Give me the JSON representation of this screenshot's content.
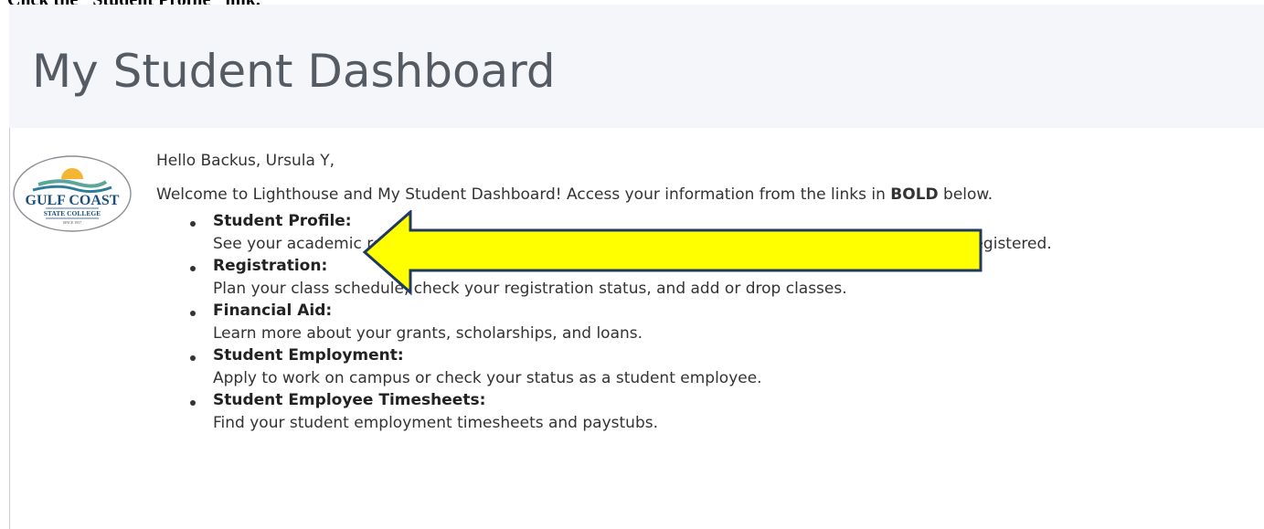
{
  "instruction": "Click the \"Student Profile\" link.",
  "page_title": "My Student Dashboard",
  "logo": {
    "name_line1": "GULF COAST",
    "name_line2": "STATE COLLEGE",
    "since": "SINCE 1957"
  },
  "greeting": "Hello Backus, Ursula Y,",
  "welcome": {
    "text_before": "Welcome to Lighthouse and My Student Dashboard! Access your information from the links in ",
    "bold": "BOLD",
    "text_after": " below."
  },
  "links": [
    {
      "title": "Student Profile:",
      "description": "See your academic records, contact information, degree, and courses in which you are currently registered."
    },
    {
      "title": "Registration:",
      "description": "Plan your class schedule, check your registration status, and add or drop classes."
    },
    {
      "title": "Financial Aid:",
      "description": "Learn more about your grants, scholarships, and loans."
    },
    {
      "title": "Student Employment:",
      "description": "Apply to work on campus or check your status as a student employee."
    },
    {
      "title": "Student Employee Timesheets:",
      "description": "Find your student employment timesheets and paystubs."
    }
  ],
  "colors": {
    "header_band": "#f5f6fa",
    "title_text": "#555b63",
    "arrow_fill": "#ffff00",
    "arrow_outline": "#1f3864"
  }
}
